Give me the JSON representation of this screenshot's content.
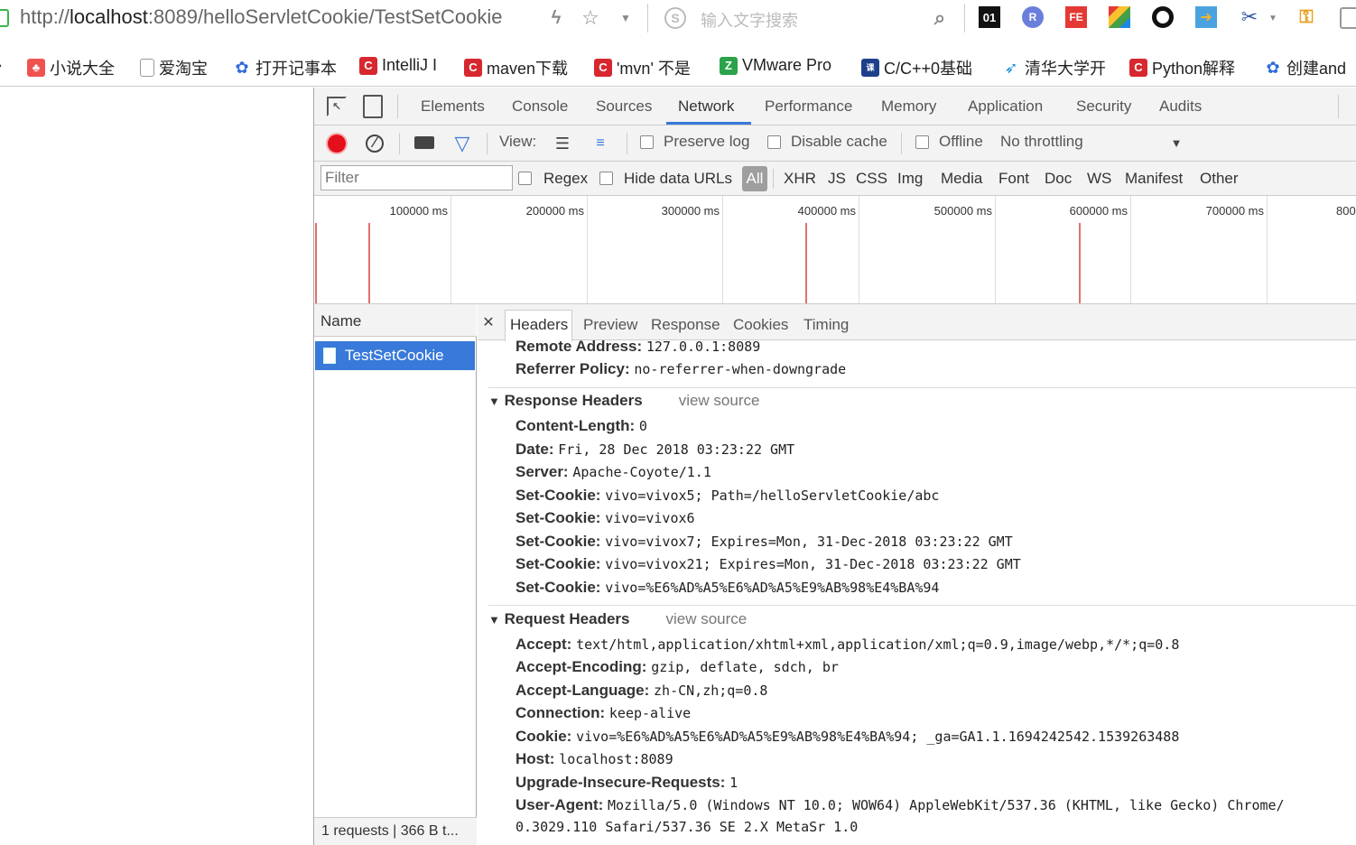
{
  "browser": {
    "url_prefix": "http://",
    "url_host": "localhost",
    "url_path": ":8089/helloServletCookie/TestSetCookie",
    "search_placeholder": "输入文字搜索"
  },
  "bookmarks": [
    {
      "label": "小说大全",
      "color": "#ef5350",
      "icon": "book-icon"
    },
    {
      "label": "爱淘宝",
      "color": "#999999",
      "icon": "page-icon"
    },
    {
      "label": "打开记事本",
      "color": "#2e6bdc",
      "icon": "paw-icon"
    },
    {
      "label": "IntelliJ I",
      "color": "#d7282f",
      "icon": "c-icon"
    },
    {
      "label": "maven下载",
      "color": "#d7282f",
      "icon": "c-icon"
    },
    {
      "label": "'mvn' 不是",
      "color": "#d7282f",
      "icon": "c-icon"
    },
    {
      "label": "VMware Pro",
      "color": "#2aa34a",
      "icon": "z-icon"
    },
    {
      "label": "C/C++0基础",
      "color": "#1e3f8a",
      "icon": "box-icon"
    },
    {
      "label": "清华大学开",
      "color": "#1a8fd8",
      "icon": "bird-icon"
    },
    {
      "label": "Python解释",
      "color": "#d7282f",
      "icon": "c-icon"
    },
    {
      "label": "创建and",
      "color": "#2e6bdc",
      "icon": "paw-icon"
    }
  ],
  "devtools": {
    "tabs": [
      "Elements",
      "Console",
      "Sources",
      "Network",
      "Performance",
      "Memory",
      "Application",
      "Security",
      "Audits"
    ],
    "active_tab": "Network",
    "toolbar": {
      "view_label": "View:",
      "preserve_log": "Preserve log",
      "disable_cache": "Disable cache",
      "offline": "Offline",
      "throttling": "No throttling"
    },
    "filter": {
      "placeholder": "Filter",
      "regex": "Regex",
      "hide_data_urls": "Hide data URLs",
      "types": [
        "All",
        "XHR",
        "JS",
        "CSS",
        "Img",
        "Media",
        "Font",
        "Doc",
        "WS",
        "Manifest",
        "Other"
      ]
    },
    "timeline_labels": [
      "100000 ms",
      "200000 ms",
      "300000 ms",
      "400000 ms",
      "500000 ms",
      "600000 ms",
      "700000 ms",
      "800"
    ],
    "name_header": "Name",
    "request_name": "TestSetCookie",
    "status": "1 requests  |  366 B t...",
    "detail_tabs": [
      "Headers",
      "Preview",
      "Response",
      "Cookies",
      "Timing"
    ],
    "general": [
      {
        "k": "Remote Address:",
        "v": "127.0.0.1:8089"
      },
      {
        "k": "Referrer Policy:",
        "v": "no-referrer-when-downgrade"
      }
    ],
    "response_title": "Response Headers",
    "request_title": "Request Headers",
    "view_source": "view source",
    "response_headers": [
      {
        "k": "Content-Length:",
        "v": "0"
      },
      {
        "k": "Date:",
        "v": "Fri, 28 Dec 2018 03:23:22 GMT"
      },
      {
        "k": "Server:",
        "v": "Apache-Coyote/1.1"
      },
      {
        "k": "Set-Cookie:",
        "v": "vivo=vivox5; Path=/helloServletCookie/abc"
      },
      {
        "k": "Set-Cookie:",
        "v": "vivo=vivox6"
      },
      {
        "k": "Set-Cookie:",
        "v": "vivo=vivox7; Expires=Mon, 31-Dec-2018 03:23:22 GMT"
      },
      {
        "k": "Set-Cookie:",
        "v": "vivo=vivox21; Expires=Mon, 31-Dec-2018 03:23:22 GMT"
      },
      {
        "k": "Set-Cookie:",
        "v": "vivo=%E6%AD%A5%E6%AD%A5%E9%AB%98%E4%BA%94"
      }
    ],
    "request_headers": [
      {
        "k": "Accept:",
        "v": "text/html,application/xhtml+xml,application/xml;q=0.9,image/webp,*/*;q=0.8"
      },
      {
        "k": "Accept-Encoding:",
        "v": "gzip, deflate, sdch, br"
      },
      {
        "k": "Accept-Language:",
        "v": "zh-CN,zh;q=0.8"
      },
      {
        "k": "Connection:",
        "v": "keep-alive"
      },
      {
        "k": "Cookie:",
        "v": "vivo=%E6%AD%A5%E6%AD%A5%E9%AB%98%E4%BA%94; _ga=GA1.1.1694242542.1539263488"
      },
      {
        "k": "Host:",
        "v": "localhost:8089"
      },
      {
        "k": "Upgrade-Insecure-Requests:",
        "v": "1"
      },
      {
        "k": "User-Agent:",
        "v": "Mozilla/5.0 (Windows NT 10.0; WOW64) AppleWebKit/537.36 (KHTML, like Gecko) Chrome/"
      }
    ],
    "user_agent_cont": "0.3029.110 Safari/537.36 SE 2.X MetaSr 1.0"
  }
}
